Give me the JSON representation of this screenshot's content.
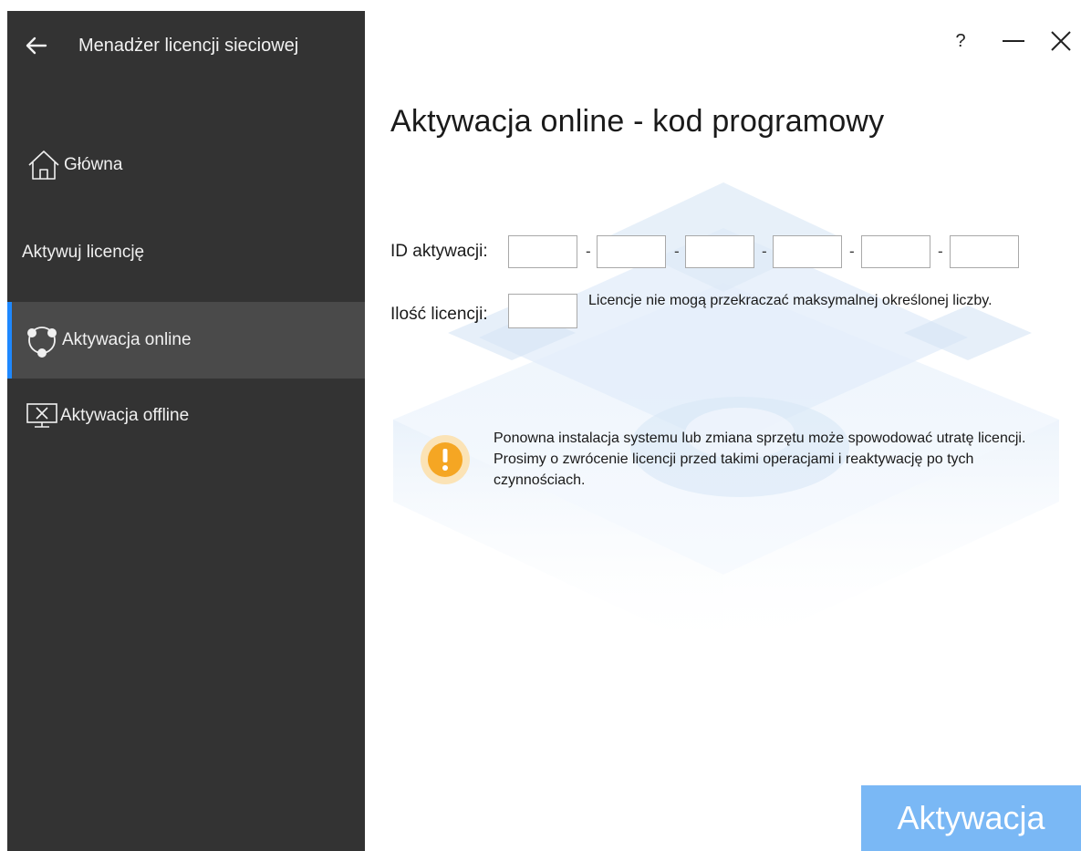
{
  "sidebar": {
    "title": "Menadżer licencji sieciowej",
    "home_label": "Główna",
    "section_label": "Aktywuj licencję",
    "items": [
      {
        "label": "Aktywacja online",
        "active": true
      },
      {
        "label": "Aktywacja offline",
        "active": false
      }
    ]
  },
  "window": {
    "help_label": "?"
  },
  "main": {
    "title": "Aktywacja online - kod programowy",
    "id_label": "ID aktywacji:",
    "id_separator": "-",
    "id_fields": [
      "",
      "",
      "",
      "",
      "",
      ""
    ],
    "qty_label": "Ilość licencji:",
    "qty_value": "",
    "qty_hint": "Licencje nie mogą przekraczać maksymalnej określonej liczby.",
    "warning_text": "Ponowna instalacja systemu lub zmiana sprzętu może spowodować utratę licencji. Prosimy o zwrócenie licencji przed takimi operacjami i reaktywację po tych czynnościach.",
    "activate_label": "Aktywacja"
  },
  "colors": {
    "sidebar_bg": "#333333",
    "active_item_bg": "#4a4a4a",
    "accent": "#1e88ff",
    "button_bg": "#7ab8f5",
    "warning": "#f5a623"
  }
}
